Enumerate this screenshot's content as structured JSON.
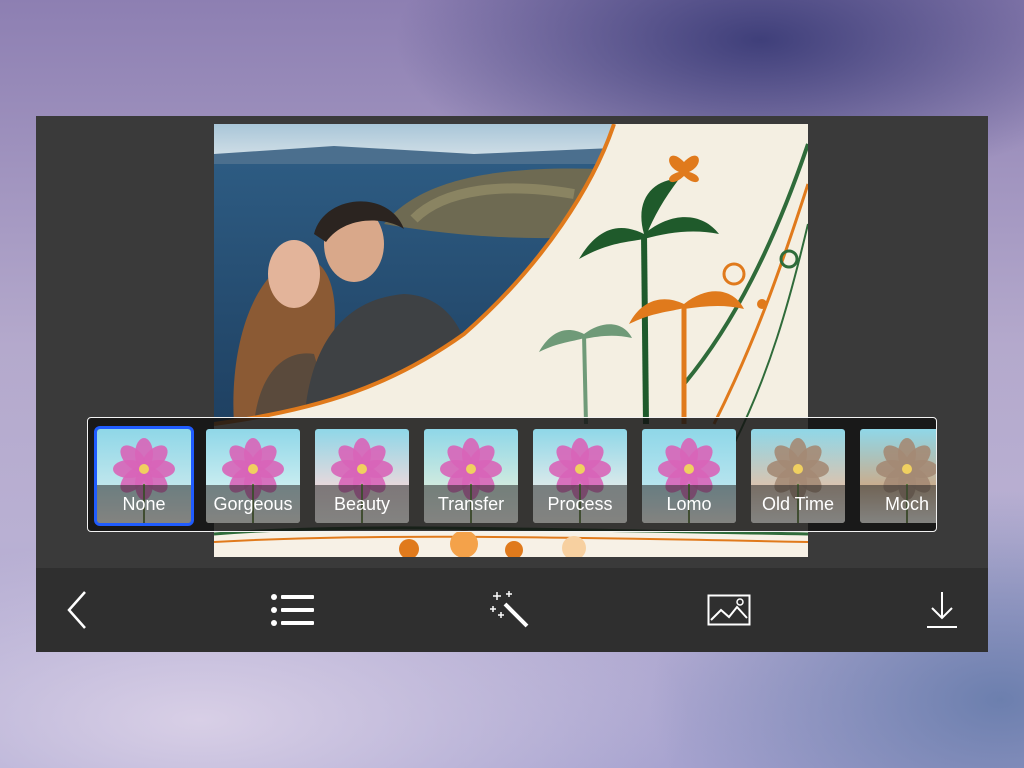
{
  "filters": [
    {
      "label": "None",
      "selected": true,
      "tint": "#bfe6ec"
    },
    {
      "label": "Gorgeous",
      "selected": false,
      "tint": "#c8ecf0"
    },
    {
      "label": "Beauty",
      "selected": false,
      "tint": "#e6d8dc"
    },
    {
      "label": "Transfer",
      "selected": false,
      "tint": "#cfeadf"
    },
    {
      "label": "Process",
      "selected": false,
      "tint": "#d9e9ea"
    },
    {
      "label": "Lomo",
      "selected": false,
      "tint": "#b6e4ee"
    },
    {
      "label": "Old Time",
      "selected": false,
      "tint": "#d9c4b0"
    },
    {
      "label": "Moch",
      "selected": false,
      "tint": "#c9ad8e"
    }
  ],
  "toolbar": {
    "icons": [
      "back-icon",
      "list-icon",
      "magic-wand-icon",
      "gallery-icon",
      "download-icon"
    ]
  },
  "colors": {
    "selection": "#1f5cff",
    "panel": "#3a3a3a",
    "toolbar": "#2f2f2f"
  }
}
